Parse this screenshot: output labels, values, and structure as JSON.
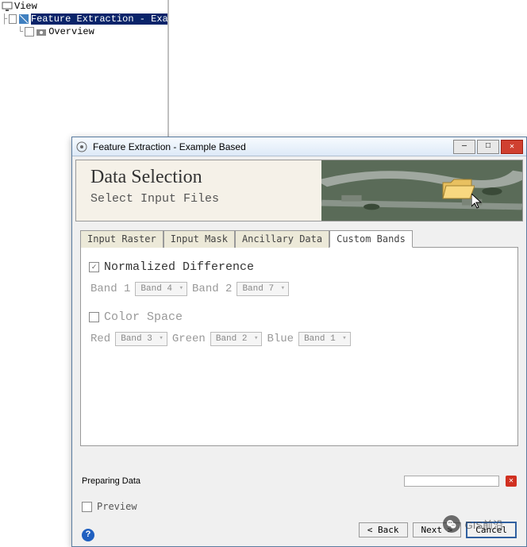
{
  "tree": {
    "root": "View",
    "item_selected": "Feature Extraction - Example Ba",
    "child": "Overview"
  },
  "dialog": {
    "title": "Feature Extraction - Example Based",
    "banner": {
      "title": "Data Selection",
      "subtitle": "Select Input Files"
    },
    "tabs": {
      "t0": "Input Raster",
      "t1": "Input Mask",
      "t2": "Ancillary Data",
      "t3": "Custom Bands"
    },
    "content": {
      "ndiff_label": "Normalized Difference",
      "band1_label": "Band 1",
      "band1_value": "Band 4",
      "band2_label": "Band 2",
      "band2_value": "Band 7",
      "colorspace_label": "Color Space",
      "red_label": "Red",
      "red_value": "Band 3",
      "green_label": "Green",
      "green_value": "Band 2",
      "blue_label": "Blue",
      "blue_value": "Band 1"
    },
    "footer": {
      "status": "Preparing Data",
      "preview": "Preview",
      "back": "< Back",
      "next": "Next >",
      "cancel": "Cancel"
    }
  },
  "watermark": {
    "text": "GIS前沿"
  }
}
